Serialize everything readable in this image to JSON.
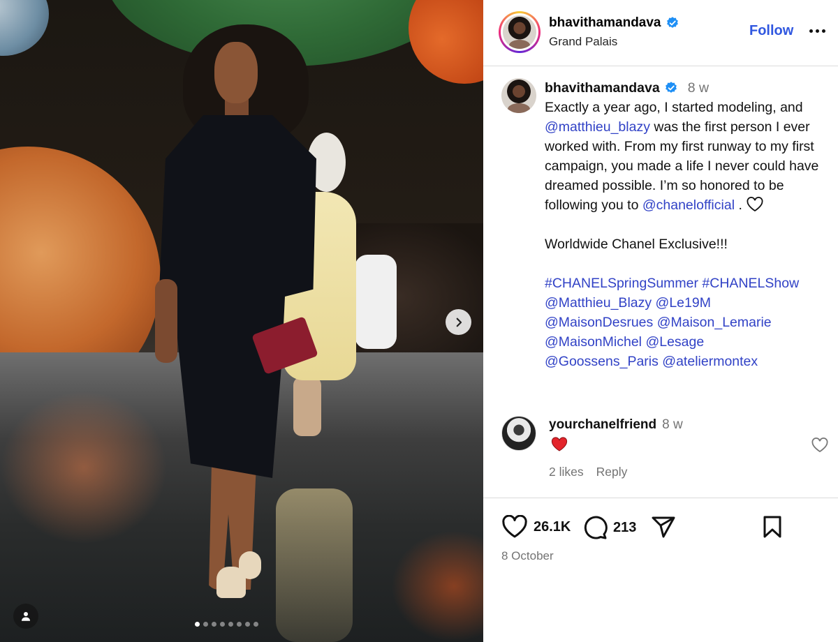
{
  "post": {
    "username": "bhavithamandava",
    "location": "Grand Palais",
    "follow_label": "Follow",
    "caption": {
      "time": "8 w",
      "text_1": "Exactly a year ago, I started modeling, and",
      "mention_1": "@matthieu_blazy",
      "text_2": "was the first person I ever worked with. From my first runway to my first campaign, you made a life I never could have dreamed possible. I’m so honored to be following you to",
      "mention_2": "@chanelofficial",
      "text_3": ".",
      "line_2": "Worldwide Chanel Exclusive!!!",
      "tags": [
        "#CHANELSpringSummer",
        "#CHANELShow",
        "@Matthieu_Blazy",
        "@Le19M",
        "@MaisonDesrues",
        "@Maison_Lemarie",
        "@MaisonMichel",
        "@Lesage",
        "@Goossens_Paris",
        "@ateliermontex"
      ]
    },
    "comment": {
      "username": "yourchanelfriend",
      "time": "8 w",
      "likes": "2 likes",
      "reply_label": "Reply"
    },
    "likes_count": "26.1K",
    "comments_count": "213",
    "date": "8 October"
  },
  "media": {
    "slide_count": 8,
    "active_slide": 1
  },
  "icons": {
    "verified": "verified-badge-icon",
    "like": "heart-icon",
    "comment": "comment-bubble-icon",
    "share": "paper-plane-icon",
    "save": "bookmark-icon",
    "more": "more-dots-icon",
    "next": "chevron-right-icon",
    "tag": "user-tag-icon"
  },
  "colors": {
    "link": "#3142c6",
    "follow": "#3057e0",
    "verified": "#1e8ff5",
    "emoji_heart": "#e3242b"
  }
}
